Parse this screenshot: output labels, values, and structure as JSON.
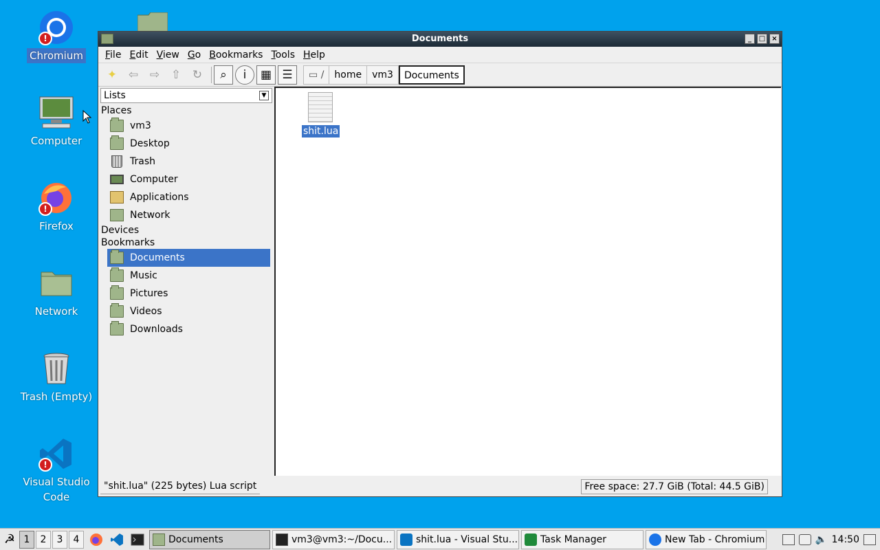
{
  "desktop": {
    "icons": [
      {
        "label": "Chromium",
        "icon": "chromium-icon",
        "badge": "!"
      },
      {
        "label": "Computer",
        "icon": "computer-icon"
      },
      {
        "label": "Firefox",
        "icon": "firefox-icon",
        "badge": "!"
      },
      {
        "label": "Network",
        "icon": "network-folder-icon"
      },
      {
        "label": "Trash (Empty)",
        "icon": "trash-icon"
      },
      {
        "label": "Visual Studio Code",
        "icon": "vscode-icon",
        "badge": "!"
      }
    ]
  },
  "window": {
    "title": "Documents",
    "buttons": {
      "minimize": "_",
      "maximize": "□",
      "close": "×"
    },
    "menu": [
      "File",
      "Edit",
      "View",
      "Go",
      "Bookmarks",
      "Tools",
      "Help"
    ],
    "toolbar_icons": [
      "new-folder-icon",
      "back-icon",
      "forward-icon",
      "up-icon",
      "reload-icon",
      "find-icon",
      "info-icon",
      "icon-view-icon",
      "list-view-icon"
    ],
    "breadcrumbs": {
      "root": "/",
      "items": [
        "home",
        "vm3"
      ],
      "current": "Documents"
    },
    "sidebar": {
      "selector": "Lists",
      "places_heading": "Places",
      "places": [
        {
          "label": "vm3",
          "icon": "home-folder-icon"
        },
        {
          "label": "Desktop",
          "icon": "desktop-folder-icon"
        },
        {
          "label": "Trash",
          "icon": "trash-icon"
        },
        {
          "label": "Computer",
          "icon": "computer-icon"
        },
        {
          "label": "Applications",
          "icon": "applications-icon"
        },
        {
          "label": "Network",
          "icon": "network-icon"
        }
      ],
      "devices_heading": "Devices",
      "bookmarks_heading": "Bookmarks",
      "bookmarks": [
        {
          "label": "Documents",
          "icon": "documents-folder-icon",
          "selected": true
        },
        {
          "label": "Music",
          "icon": "music-folder-icon"
        },
        {
          "label": "Pictures",
          "icon": "pictures-folder-icon"
        },
        {
          "label": "Videos",
          "icon": "videos-folder-icon"
        },
        {
          "label": "Downloads",
          "icon": "downloads-folder-icon"
        }
      ]
    },
    "files": [
      {
        "name": "shit.lua",
        "icon": "text-file-icon",
        "selected": true
      }
    ],
    "status_left": "\"shit.lua\" (225 bytes) Lua script",
    "status_right": "Free space: 27.7 GiB (Total: 44.5 GiB)"
  },
  "taskbar": {
    "desktops": [
      "1",
      "2",
      "3",
      "4"
    ],
    "active_desktop": "1",
    "launchers": [
      "firefox-icon",
      "vscode-icon",
      "terminal-icon"
    ],
    "tasks": [
      {
        "label": "Documents",
        "icon": "folder-icon",
        "active": true
      },
      {
        "label": "vm3@vm3:~/Docu...",
        "icon": "terminal-icon"
      },
      {
        "label": "shit.lua - Visual Stu...",
        "icon": "vscode-icon"
      },
      {
        "label": "Task Manager",
        "icon": "task-manager-icon"
      },
      {
        "label": "New Tab - Chromium",
        "icon": "chromium-icon"
      }
    ],
    "clock": "14:50"
  },
  "colors": {
    "desktop": "#00a2ed",
    "selection": "#3b74c8"
  }
}
